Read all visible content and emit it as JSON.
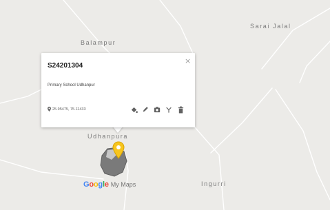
{
  "map": {
    "background_color": "#ecebe8",
    "road_color": "#ffffff",
    "labels": {
      "balampur": "Balampur",
      "sarai_jalal": "Sarai Jalal",
      "udhanpura": "Udhanpura",
      "ingurri": "Ingurri"
    }
  },
  "popup": {
    "title": "S24201304",
    "close": "×",
    "description": "Primary School Udhanpur",
    "coordinates": "25.95475, 75.11433",
    "tools": [
      "style-icon",
      "edit-icon",
      "photo-icon",
      "directions-icon",
      "delete-icon"
    ]
  },
  "marker": {
    "color": "#f7c51e",
    "area_color": "#7a7a7a"
  },
  "branding": {
    "google_letters": [
      "G",
      "o",
      "o",
      "g",
      "l",
      "e"
    ],
    "google_colors": [
      "#4285f4",
      "#ea4335",
      "#fbbc05",
      "#4285f4",
      "#34a853",
      "#ea4335"
    ],
    "suffix": "My Maps"
  }
}
